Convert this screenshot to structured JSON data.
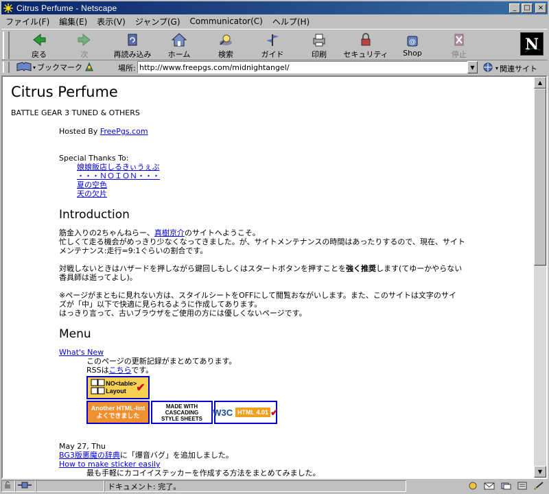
{
  "window": {
    "title": "Citrus Perfume - Netscape",
    "controls": {
      "minimize": "_",
      "maximize": "□",
      "close": "×"
    }
  },
  "menu": [
    "ファイル(F)",
    "編集(E)",
    "表示(V)",
    "ジャンプ(G)",
    "Communicator(C)",
    "ヘルプ(H)"
  ],
  "toolbar": [
    {
      "label": "戻る",
      "icon": "back-icon",
      "enabled": true
    },
    {
      "label": "次",
      "icon": "forward-icon",
      "enabled": false
    },
    {
      "label": "再読み込み",
      "icon": "reload-icon",
      "enabled": true
    },
    {
      "label": "ホーム",
      "icon": "home-icon",
      "enabled": true
    },
    {
      "label": "検索",
      "icon": "search-icon",
      "enabled": true
    },
    {
      "label": "ガイド",
      "icon": "guide-icon",
      "enabled": true
    },
    {
      "label": "印刷",
      "icon": "print-icon",
      "enabled": true
    },
    {
      "label": "セキュリティ",
      "icon": "security-icon",
      "enabled": true
    },
    {
      "label": "Shop",
      "icon": "shop-icon",
      "enabled": true
    },
    {
      "label": "停止",
      "icon": "stop-icon",
      "enabled": false
    }
  ],
  "location": {
    "bookmark_label": "ブックマーク",
    "location_label": "場所:",
    "url": "http://www.freepgs.com/midnightangel/",
    "related_label": "関連サイト"
  },
  "page": {
    "title": "Citrus Perfume",
    "subtitle": "BATTLE GEAR 3 TUNED & OTHERS",
    "hosted_prefix": "Hosted By ",
    "hosted_link": "FreePgs.com",
    "thanks_heading": "Special Thanks To:",
    "thanks_links": [
      "娘娘飯店しるきぃうぇぶ",
      "・・・ＮＯＩＯＮ・・・",
      "夏の空色",
      "天の欠片"
    ],
    "intro_heading": "Introduction",
    "intro_p1_pre": "筋金入りの2ちゃんねらー、",
    "intro_p1_link": "真樹京介",
    "intro_p1_post": "のサイトへようこそ。",
    "intro_p1_line2": "忙しくて走る機会がめっきり少なくなってきました。が、サイトメンテナンスの時間はあったりするので、現在、サイト",
    "intro_p1_line3": "メンテナンス:走行=9:1ぐらいの割合です。",
    "intro_p2_pre": "対戦しないときはハザードを押しながら鍵回しもしくはスタートボタンを押すことを",
    "intro_p2_bold": "強く推奨",
    "intro_p2_post": "します(てゆーかやらない",
    "intro_p2_line2": "香具師は逝ってよし)。",
    "intro_p3_line1": "※ページがまともに見れない方は、スタイルシートをOFFにして閲覧おながいします。また、このサイトは文字のサイ",
    "intro_p3_line2": "ズが「中」以下で快適に見られるように作成してあります。",
    "intro_p3_line3": "はっきり言って、古いブラウザをご使用の方には優しくないページです。",
    "menu_heading": "Menu",
    "whats_new_link": "What's New",
    "whats_new_desc": "このページの更新記録がまとめてあります。",
    "rss_pre": "RSSは",
    "rss_link": "こちら",
    "rss_post": "です。",
    "badges": {
      "b1": "NO<table> Layout",
      "b2_line1": "Another HTML-lint",
      "b2_line2": "よくできました",
      "b3_line1": "MADE WITH",
      "b3_line2": "CASCADING",
      "b3_line3": "STYLE SHEETS",
      "b4_w3c": "W3C",
      "b4_html": "HTML 4.01"
    },
    "date": "May 27, Thu",
    "news1_link": "BG3版悪魔の辞典",
    "news1_post": "に「爆音バグ」を追加しました。",
    "news2_link": "How to make sticker easily",
    "news2_desc": "最も手軽にカコイイステッカーを作成する方法をまとめてみました。"
  },
  "status": {
    "text": "ドキュメント: 完了。"
  }
}
